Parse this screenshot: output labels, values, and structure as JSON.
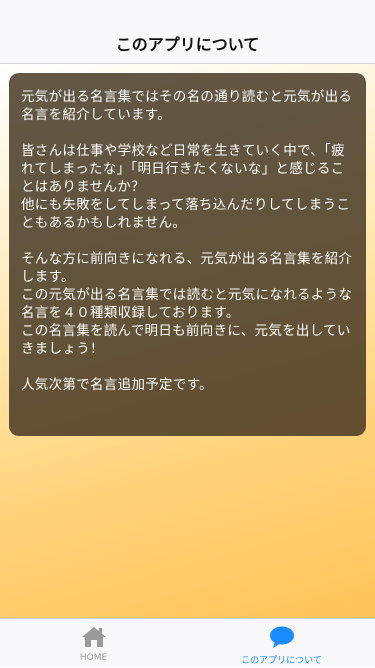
{
  "nav": {
    "title": "このアプリについて"
  },
  "about": {
    "text": "元気が出る名言集ではその名の通り読むと元気が出る名言を紹介しています。\n\n皆さんは仕事や学校など日常を生きていく中で、「疲れてしまったな」「明日行きたくないな」と感じることはありませんか？\n他にも失敗をしてしまって落ち込んだりしてしまうこともあるかもしれません。\n\nそんな方に前向きになれる、元気が出る名言集を紹介します。\nこの元気が出る名言集では読むと元気になれるような名言を４０種類収録しております。\nこの名言集を読んで明日も前向きに、元気を出していきましょう！\n\n人気次第で名言追加予定です。"
  },
  "tabs": {
    "home": {
      "label": "HOME",
      "icon": "home-icon",
      "color": "#999999"
    },
    "about": {
      "label": "このアプリについて",
      "icon": "speech-bubble-icon",
      "color": "#1a8cff",
      "selected": true
    }
  }
}
